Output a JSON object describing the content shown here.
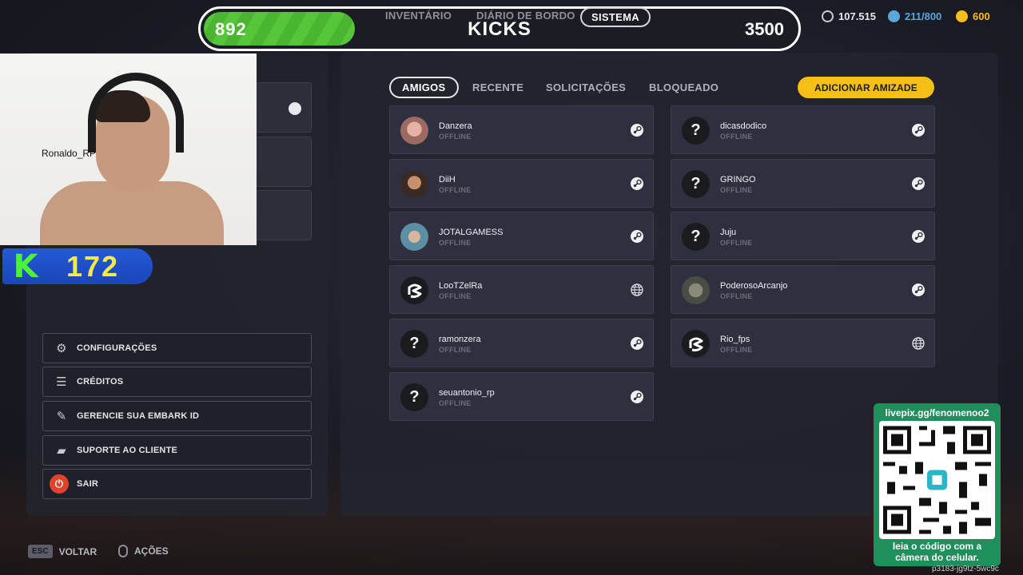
{
  "top_bar": {
    "kicks_current": "892",
    "kicks_title": "KICKS",
    "kicks_goal": "3500",
    "progress_fraction": 0.255,
    "tabs": [
      "INVENTÁRIO",
      "DIÁRIO DE BORDO",
      "SISTEMA"
    ],
    "active_tab": "SISTEMA"
  },
  "currencies": [
    {
      "value": "107.515",
      "icon": "multibucks-icon",
      "color": "#c9cad2"
    },
    {
      "value": "211/800",
      "icon": "gold-coin-icon",
      "color": "#5aa7d8"
    },
    {
      "value": "600",
      "icon": "bars-icon",
      "color": "#f6bf17"
    }
  ],
  "webcam": {
    "name": "Ronaldo_RP"
  },
  "kick_counter": {
    "value": "172",
    "logo": "K"
  },
  "menu": {
    "items": [
      {
        "label": "CONFIGURAÇÕES",
        "icon": "gear-icon"
      },
      {
        "label": "CRÉDITOS",
        "icon": "credits-icon"
      },
      {
        "label": "GERENCIE SUA EMBARK ID",
        "icon": "embark-icon"
      },
      {
        "label": "SUPORTE AO CLIENTE",
        "icon": "support-icon"
      },
      {
        "label": "SAIR",
        "icon": "power-icon"
      }
    ]
  },
  "friends": {
    "tabs": [
      "AMIGOS",
      "RECENTE",
      "SOLICITAÇÕES",
      "BLOQUEADO"
    ],
    "active_tab": "AMIGOS",
    "add_button": "ADICIONAR AMIZADE",
    "left_column": [
      {
        "name": "Danzera",
        "status": "OFFLINE",
        "avatar": "photo",
        "platform": "steam-icon"
      },
      {
        "name": "DiiH",
        "status": "OFFLINE",
        "avatar": "photo",
        "platform": "steam-icon"
      },
      {
        "name": "JOTALGAMESS",
        "status": "OFFLINE",
        "avatar": "photo",
        "platform": "steam-icon"
      },
      {
        "name": "LooTZelRa",
        "status": "OFFLINE",
        "avatar": "embark-logo",
        "platform": "globe-icon"
      },
      {
        "name": "ramonzera",
        "status": "OFFLINE",
        "avatar": "question",
        "platform": "steam-icon"
      },
      {
        "name": "seuantonio_rp",
        "status": "OFFLINE",
        "avatar": "question",
        "platform": "steam-icon"
      }
    ],
    "right_column": [
      {
        "name": "dicasdodico",
        "status": "OFFLINE",
        "avatar": "question",
        "platform": "steam-icon"
      },
      {
        "name": "GRINGO",
        "status": "OFFLINE",
        "avatar": "question",
        "platform": "steam-icon"
      },
      {
        "name": "Juju",
        "status": "OFFLINE",
        "avatar": "question",
        "platform": "steam-icon"
      },
      {
        "name": "PoderosoArcanjo",
        "status": "OFFLINE",
        "avatar": "photo",
        "platform": "steam-icon"
      },
      {
        "name": "Rio_fps",
        "status": "OFFLINE",
        "avatar": "embark-logo",
        "platform": "globe-icon"
      }
    ]
  },
  "qr": {
    "url": "livepix.gg/fenomenoo2",
    "caption_line1": "leia o código com a",
    "caption_line2": "câmera do celular."
  },
  "bottom_code": "p3183-jg9tz-5wc9c",
  "hints": [
    {
      "key": "ESC",
      "label": "VOLTAR"
    },
    {
      "key": "",
      "label": "AÇÕES"
    }
  ]
}
